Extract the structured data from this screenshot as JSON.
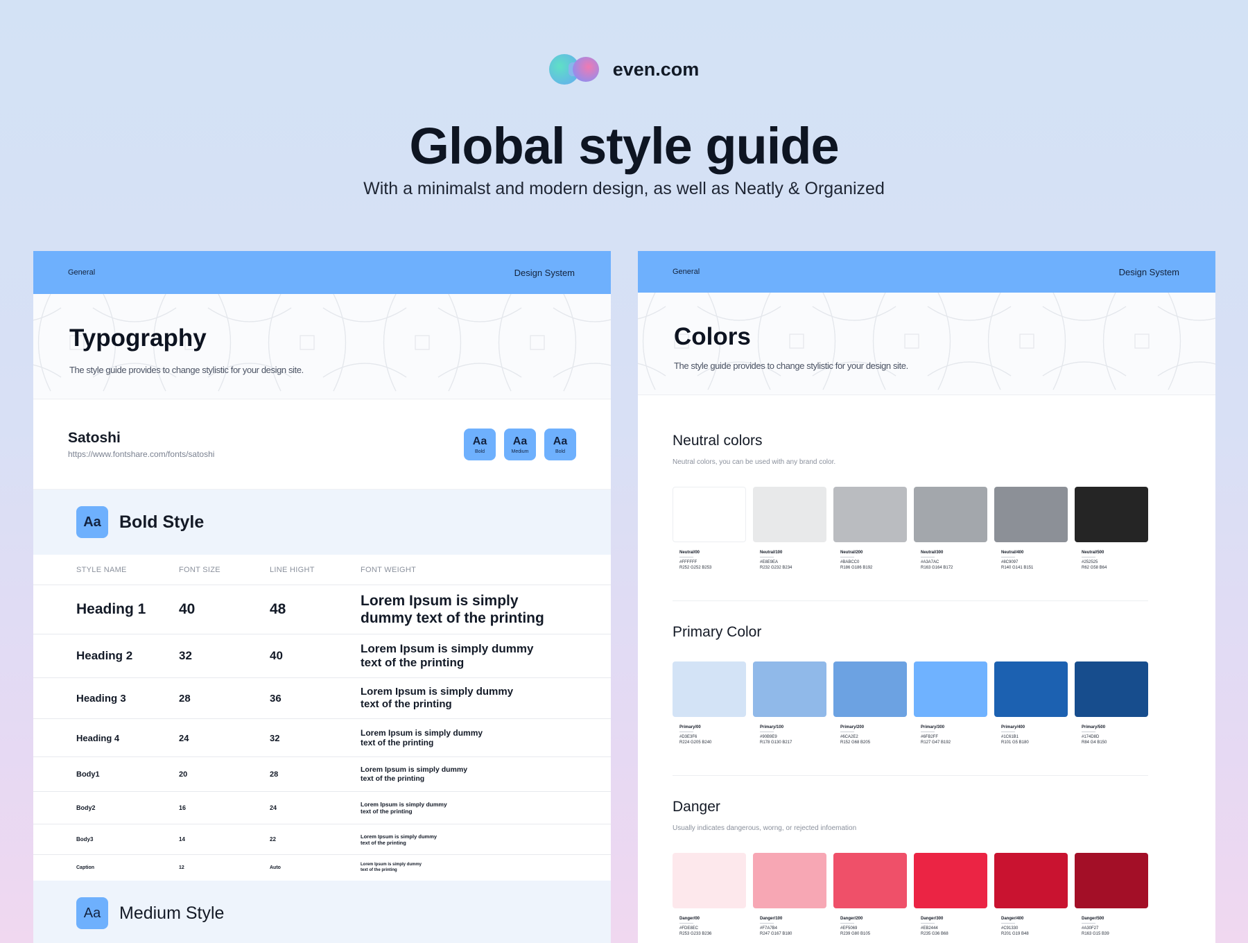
{
  "brand": {
    "name": "even.com"
  },
  "header": {
    "title": "Global style guide",
    "subtitle": "With a minimalst and modern design, as well as Neatly & Organized"
  },
  "typography_panel": {
    "bar_left": "General",
    "bar_right": "Design System",
    "title": "Typography",
    "description": "The style guide provides to change stylistic for your design site.",
    "font_name": "Satoshi",
    "font_url": "https://www.fontshare.com/fonts/satoshi",
    "chips": [
      {
        "aa": "Aa",
        "weight": "Bold"
      },
      {
        "aa": "Aa",
        "weight": "Medium"
      },
      {
        "aa": "Aa",
        "weight": "Bold"
      }
    ],
    "bold_style": {
      "icon": "Aa",
      "label": "Bold Style"
    },
    "medium_style": {
      "icon": "Aa",
      "label": "Medium Style"
    },
    "columns": [
      "STYLE NAME",
      "FONT SIZE",
      "LINE HIGHT",
      "FONT WEIGHT"
    ],
    "rows": [
      {
        "name": "Heading 1",
        "size": "40",
        "line": "48",
        "sample": "Lorem Ipsum is simply dummy text of the printing"
      },
      {
        "name": "Heading 2",
        "size": "32",
        "line": "40",
        "sample": "Lorem Ipsum is simply dummy text of the printing"
      },
      {
        "name": "Heading 3",
        "size": "28",
        "line": "36",
        "sample": "Lorem Ipsum is simply dummy text of the printing"
      },
      {
        "name": "Heading 4",
        "size": "24",
        "line": "32",
        "sample": "Lorem Ipsum is simply dummy text of the printing"
      },
      {
        "name": "Body1",
        "size": "20",
        "line": "28",
        "sample": "Lorem Ipsum is simply dummy text of the printing"
      },
      {
        "name": "Body2",
        "size": "16",
        "line": "24",
        "sample": "Lorem Ipsum is simply dummy text of the printing"
      },
      {
        "name": "Body3",
        "size": "14",
        "line": "22",
        "sample": "Lorem Ipsum is simply dummy text of the printing"
      },
      {
        "name": "Caption",
        "size": "12",
        "line": "Auto",
        "sample": "Lorem Ipsum is simply dummy text of the printing"
      }
    ]
  },
  "colors_panel": {
    "bar_left": "General",
    "bar_right": "Design System",
    "title": "Colors",
    "description": "The style guide provides to change stylistic for your design site.",
    "neutral": {
      "title": "Neutral colors",
      "description": "Neutral colors, you can be used with any brand color.",
      "swatches": [
        {
          "name": "Neutral/00",
          "hex": "#FFFFFF",
          "rgb": "R252 G252 B253",
          "color": "#FFFFFF"
        },
        {
          "name": "Neutral/100",
          "hex": "#E8E9EA",
          "rgb": "R232 G232 B234",
          "color": "#E8E9EA"
        },
        {
          "name": "Neutral/200",
          "hex": "#BABCC0",
          "rgb": "R186 G186 B192",
          "color": "#BABCC0"
        },
        {
          "name": "Neutral/300",
          "hex": "#A3A7AC",
          "rgb": "R163 G164 B172",
          "color": "#A3A7AC"
        },
        {
          "name": "Neutral/400",
          "hex": "#8C9097",
          "rgb": "R140 G141 B151",
          "color": "#8C9097"
        },
        {
          "name": "Neutral/500",
          "hex": "#252525",
          "rgb": "R62 G58 B64",
          "color": "#252525"
        }
      ]
    },
    "primary": {
      "title": "Primary Color",
      "swatches": [
        {
          "name": "Primary/00",
          "hex": "#D3E3F6",
          "rgb": "R224 G205 B240",
          "color": "#D3E3F6"
        },
        {
          "name": "Primary/100",
          "hex": "#90B9E9",
          "rgb": "R178 G130 B217",
          "color": "#90B9E9"
        },
        {
          "name": "Primary/200",
          "hex": "#6CA2E2",
          "rgb": "R152 G68 B205",
          "color": "#6CA2E2"
        },
        {
          "name": "Primary/300",
          "hex": "#6FB2FF",
          "rgb": "R127 G47 B192",
          "color": "#6FB2FF"
        },
        {
          "name": "Primary/400",
          "hex": "#1C61B1",
          "rgb": "R101 G5 B180",
          "color": "#1C61B1"
        },
        {
          "name": "Primary/500",
          "hex": "#174D8D",
          "rgb": "R84 G4 B150",
          "color": "#174D8D"
        }
      ]
    },
    "danger": {
      "title": "Danger",
      "description": "Usually indicates dangerous, worng, or rejected infoemation",
      "swatches": [
        {
          "name": "Danger/00",
          "hex": "#FDE8EC",
          "rgb": "R253 G233 B236",
          "color": "#FDE8EC"
        },
        {
          "name": "Danger/100",
          "hex": "#F7A7B4",
          "rgb": "R247 G167 B180",
          "color": "#F7A7B4"
        },
        {
          "name": "Danger/200",
          "hex": "#EF5069",
          "rgb": "R239 G80 B105",
          "color": "#EF5069"
        },
        {
          "name": "Danger/300",
          "hex": "#EB2444",
          "rgb": "R235 G36 B68",
          "color": "#EB2444"
        },
        {
          "name": "Danger/400",
          "hex": "#C91330",
          "rgb": "R201 G19 B48",
          "color": "#C91330"
        },
        {
          "name": "Danger/500",
          "hex": "#A30F27",
          "rgb": "R163 G15 B39",
          "color": "#A30F27"
        }
      ]
    }
  },
  "colors": {
    "accent": "#6EB0FD",
    "banner_bg": "#EEF4FC"
  }
}
